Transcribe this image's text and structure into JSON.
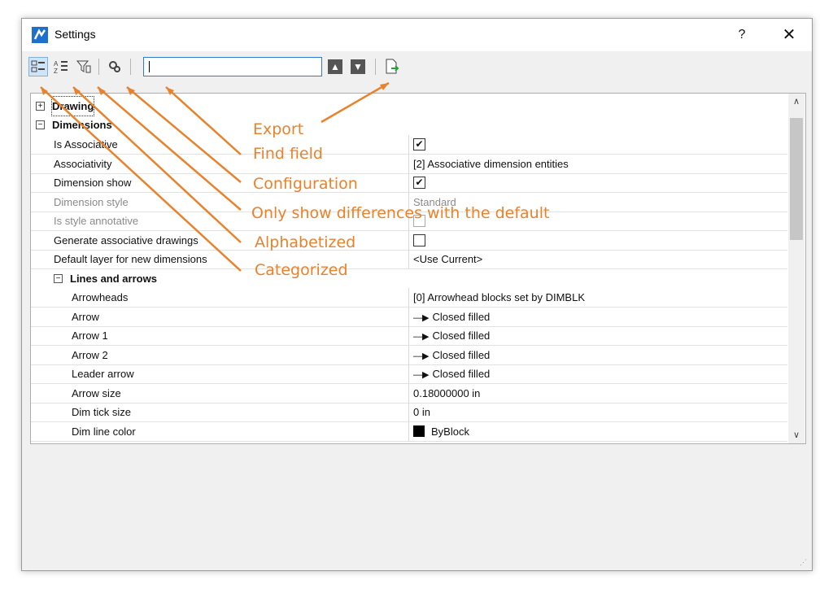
{
  "window": {
    "title": "Settings",
    "help": "?",
    "close": "✕"
  },
  "toolbar": {
    "categorized_icon": "categorized-icon",
    "alphabetized_icon": "alphabetized-icon",
    "differences_icon": "filter-icon",
    "configuration_icon": "configuration-icon",
    "find_placeholder": "",
    "up_icon": "arrow-up-icon",
    "down_icon": "arrow-down-icon",
    "export_icon": "export-icon"
  },
  "grid": {
    "categories": [
      {
        "label": "Drawing",
        "expanded": false
      },
      {
        "label": "Dimensions",
        "expanded": true
      }
    ],
    "dimension_props": [
      {
        "name": "Is Associative",
        "value": "",
        "checkbox": true,
        "checked": true,
        "disabled": false
      },
      {
        "name": "Associativity",
        "value": "[2] Associative dimension entities",
        "checkbox": false,
        "disabled": false
      },
      {
        "name": "Dimension show",
        "value": "",
        "checkbox": true,
        "checked": true,
        "disabled": false
      },
      {
        "name": "Dimension style",
        "value": "Standard",
        "checkbox": false,
        "disabled": true
      },
      {
        "name": "Is style annotative",
        "value": "",
        "checkbox": true,
        "checked": false,
        "disabled": true
      },
      {
        "name": "Generate associative drawings",
        "value": "",
        "checkbox": true,
        "checked": false,
        "disabled": false
      },
      {
        "name": "Default layer for new dimensions",
        "value": "<Use Current>",
        "checkbox": false,
        "disabled": false
      }
    ],
    "subcategory": "Lines and arrows",
    "lines_props": [
      {
        "name": "Arrowheads",
        "value": "[0] Arrowhead blocks set by DIMBLK"
      },
      {
        "name": "Arrow",
        "value": "Closed filled"
      },
      {
        "name": "Arrow 1",
        "value": "Closed filled"
      },
      {
        "name": "Arrow 2",
        "value": "Closed filled"
      },
      {
        "name": "Leader arrow",
        "value": "Closed filled"
      },
      {
        "name": "Arrow size",
        "value": "0.18000000 in"
      },
      {
        "name": "Dim tick size",
        "value": "0 in"
      },
      {
        "name": "Dim line color",
        "value": "ByBlock"
      }
    ]
  },
  "annotations": {
    "export": "Export",
    "find": "Find field",
    "configuration": "Configuration",
    "differences": "Only show differences with the default",
    "alphabetized": "Alphabetized",
    "categorized": "Categorized"
  },
  "colors": {
    "annotation": "#e8822c",
    "accent": "#2e7bcf"
  }
}
